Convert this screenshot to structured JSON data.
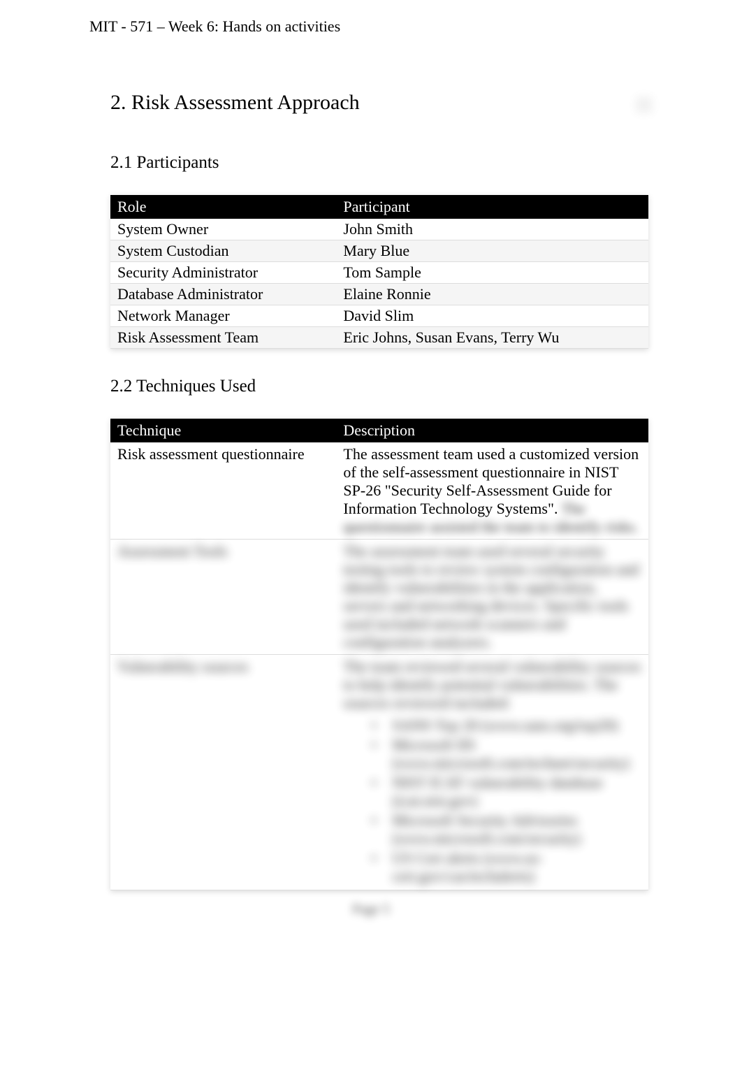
{
  "header": "MIT - 571 – Week 6: Hands on activities",
  "section": {
    "number_title": "2. Risk Assessment Approach"
  },
  "participants": {
    "heading": "2.1 Participants",
    "columns": {
      "role": "Role",
      "participant": "Participant"
    },
    "rows": [
      {
        "role": "System Owner",
        "participant": "John Smith"
      },
      {
        "role": "System Custodian",
        "participant": "Mary Blue"
      },
      {
        "role": "Security Administrator",
        "participant": "Tom Sample"
      },
      {
        "role": "Database Administrator",
        "participant": "Elaine Ronnie"
      },
      {
        "role": "Network Manager",
        "participant": "David Slim"
      },
      {
        "role": "Risk Assessment Team",
        "participant": "Eric Johns, Susan Evans, Terry Wu"
      }
    ]
  },
  "techniques": {
    "heading": "2.2 Techniques Used",
    "columns": {
      "technique": "Technique",
      "description": "Description"
    },
    "rows": [
      {
        "technique": "Risk assessment questionnaire",
        "description_clear": "The assessment team used a customized version of the self-assessment questionnaire in NIST SP-26 \"Security Self-Assessment Guide for Information Technology Systems\".",
        "description_blurred": "The questionnaire assisted the team to identify risks."
      },
      {
        "technique": "Assessment Tools",
        "description": "The assessment team used several security testing tools to review system configuration and identify vulnerabilities in the application, servers and networking devices. Specific tools used included network scanners and configuration analyzers."
      },
      {
        "technique": "Vulnerability sources",
        "description": "The team reviewed several vulnerability sources to help identify potential vulnerabilities. The sources reviewed included:",
        "list": [
          "SANS Top 20 (www.sans.org/top20)",
          "Microsoft IIS (www.microsoft.com/technet/security)",
          "NIST ICAT vulnerability database (icat.nist.gov)",
          "Microsoft Security Advisories (www.microsoft.com/security)",
          "US Cert alerts (www.us-cert.gov/cas/techalerts)"
        ]
      }
    ]
  },
  "page_number": "Page 5"
}
